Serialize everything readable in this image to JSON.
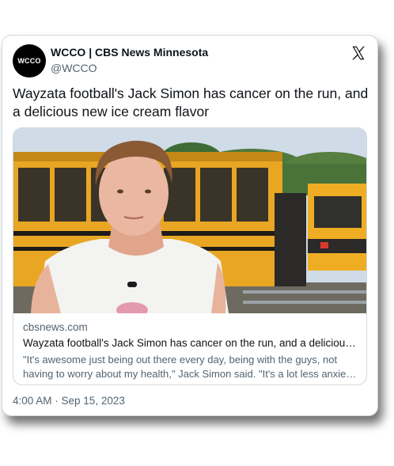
{
  "author": {
    "avatar_text": "WCCO",
    "name": "WCCO | CBS News Minnesota",
    "handle": "@WCCO"
  },
  "icons": {
    "platform": "x-logo-icon"
  },
  "tweet": {
    "text": "Wayzata football's Jack Simon has cancer on the run, and a delicious new ice cream flavor",
    "timestamp": "4:00 AM · Sep 15, 2023"
  },
  "link_card": {
    "domain": "cbsnews.com",
    "title": "Wayzata football's Jack Simon has cancer on the run, and a delicious new ice cream flavor",
    "description": "\"It's awesome just being out there every day, being with the guys, not having to worry about my health,\" Jack Simon said. \"It's a lot less anxiety about that kind of stuff.\""
  },
  "colors": {
    "text_primary": "#0f1419",
    "text_secondary": "#536471",
    "border": "#cfd9de",
    "bus_yellow": "#e8a623"
  }
}
